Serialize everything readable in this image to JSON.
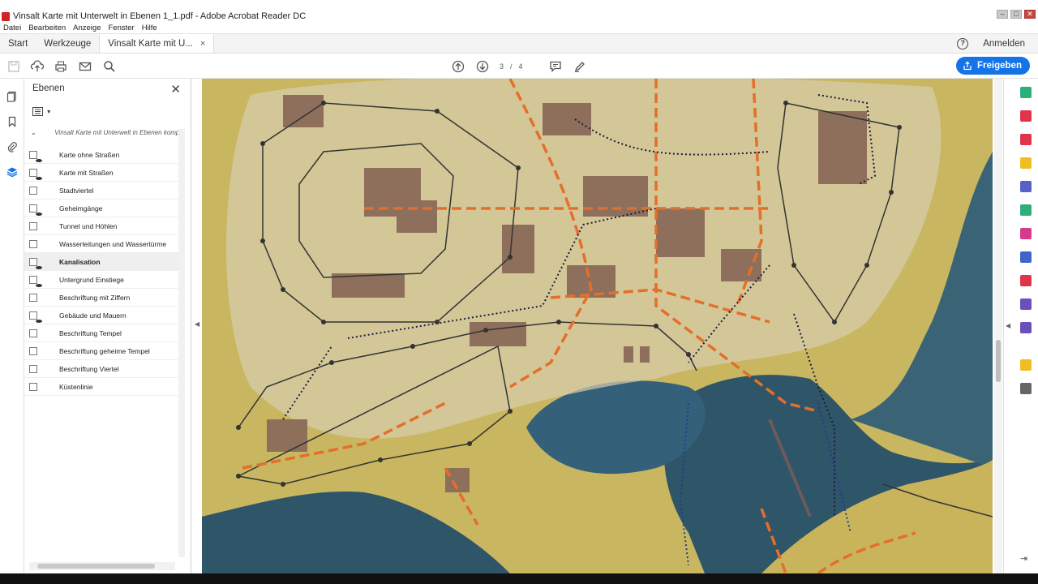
{
  "window": {
    "title": "Vinsalt Karte mit Unterwelt in Ebenen 1_1.pdf - Adobe Acrobat Reader DC",
    "controls": [
      "–",
      "□",
      "✕"
    ]
  },
  "menu": [
    "Datei",
    "Bearbeiten",
    "Anzeige",
    "Fenster",
    "Hilfe"
  ],
  "tabs": {
    "start": "Start",
    "tools": "Werkzeuge",
    "document": "Vinsalt Karte mit U...",
    "close": "×",
    "help": "?",
    "signin": "Anmelden"
  },
  "toolbar": {
    "page_current": "3",
    "page_sep": "/",
    "page_total": "4",
    "share_label": "Freigeben"
  },
  "panel": {
    "title": "Ebenen",
    "close": "✕",
    "root_label": "Vinsalt Karte mit Unterwelt in Ebenen komp",
    "layers": [
      {
        "label": "Karte ohne Straßen",
        "visible": true
      },
      {
        "label": "Karte mit Straßen",
        "visible": true
      },
      {
        "label": "Stadtviertel",
        "visible": false
      },
      {
        "label": "Geheimgänge",
        "visible": true
      },
      {
        "label": "Tunnel und Höhlen",
        "visible": false
      },
      {
        "label": "Wasserleitungen und Wassertürme",
        "visible": false
      },
      {
        "label": "Kanalisation",
        "visible": true
      },
      {
        "label": "Untergrund Einstiege",
        "visible": true
      },
      {
        "label": "Beschriftung mit Ziffern",
        "visible": false
      },
      {
        "label": "Gebäude und Mauern",
        "visible": true
      },
      {
        "label": "Beschriftung Tempel",
        "visible": false
      },
      {
        "label": "Beschriftung geheime Tempel",
        "visible": false
      },
      {
        "label": "Beschriftung Viertel",
        "visible": false
      },
      {
        "label": "Küstenlinie",
        "visible": false
      }
    ]
  },
  "colors": {
    "accent": "#1473e6",
    "land": "#c9b660",
    "water": "#2f5568",
    "roads": "#e46f2a"
  }
}
